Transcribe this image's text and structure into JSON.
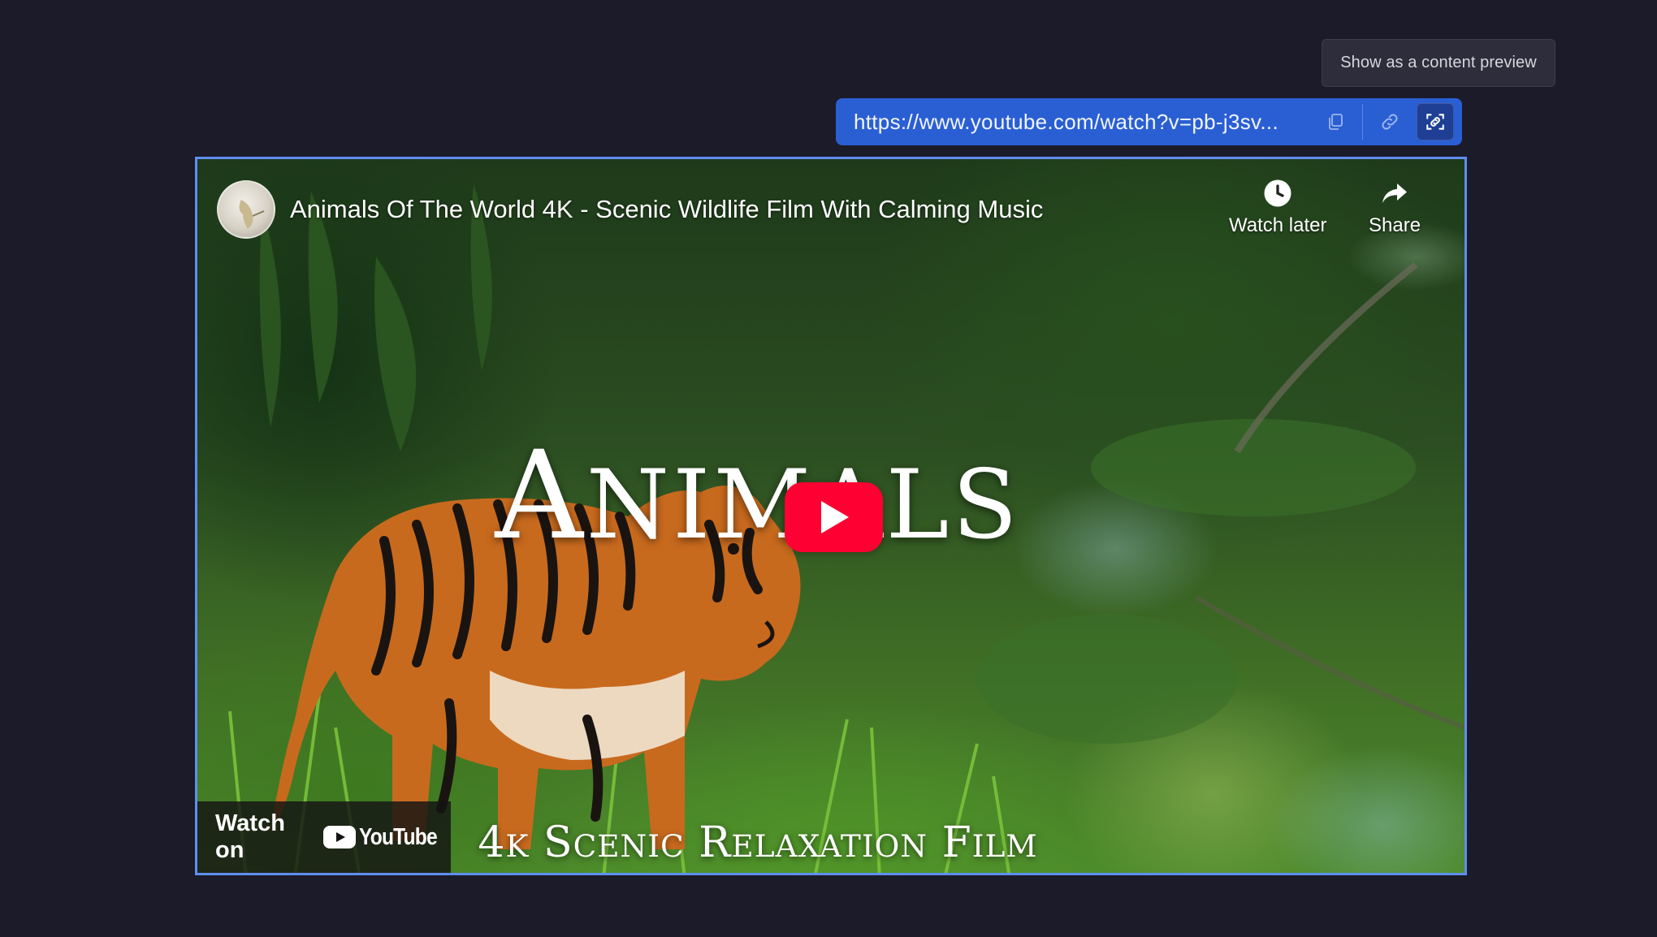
{
  "tooltip": {
    "text": "Show as a content preview"
  },
  "url_bar": {
    "url": "https://www.youtube.com/watch?v=pb-j3sv...",
    "icons": [
      "copy-icon",
      "link-icon",
      "preview-link-icon"
    ]
  },
  "embed": {
    "video_title": "Animals Of The World 4K - Scenic Wildlife Film With Calming Music",
    "actions": {
      "watch_later": "Watch later",
      "share": "Share"
    },
    "thumbnail": {
      "title_initial": "A",
      "title_rest": "NIMALS",
      "subtitle_parts": [
        {
          "big": "4",
          "small": "K"
        },
        {
          "big": "S",
          "small": "CENIC"
        },
        {
          "big": "R",
          "small": "ELAXATION"
        },
        {
          "big": "F",
          "small": "ILM"
        }
      ]
    },
    "watch_on": {
      "label": "Watch on",
      "brand": "YouTube"
    },
    "colors": {
      "play_button": "#ff0033",
      "frame_border": "#5f8ef0"
    }
  },
  "colors": {
    "background": "#1b1b29",
    "url_bar": "#2a5fd4"
  }
}
